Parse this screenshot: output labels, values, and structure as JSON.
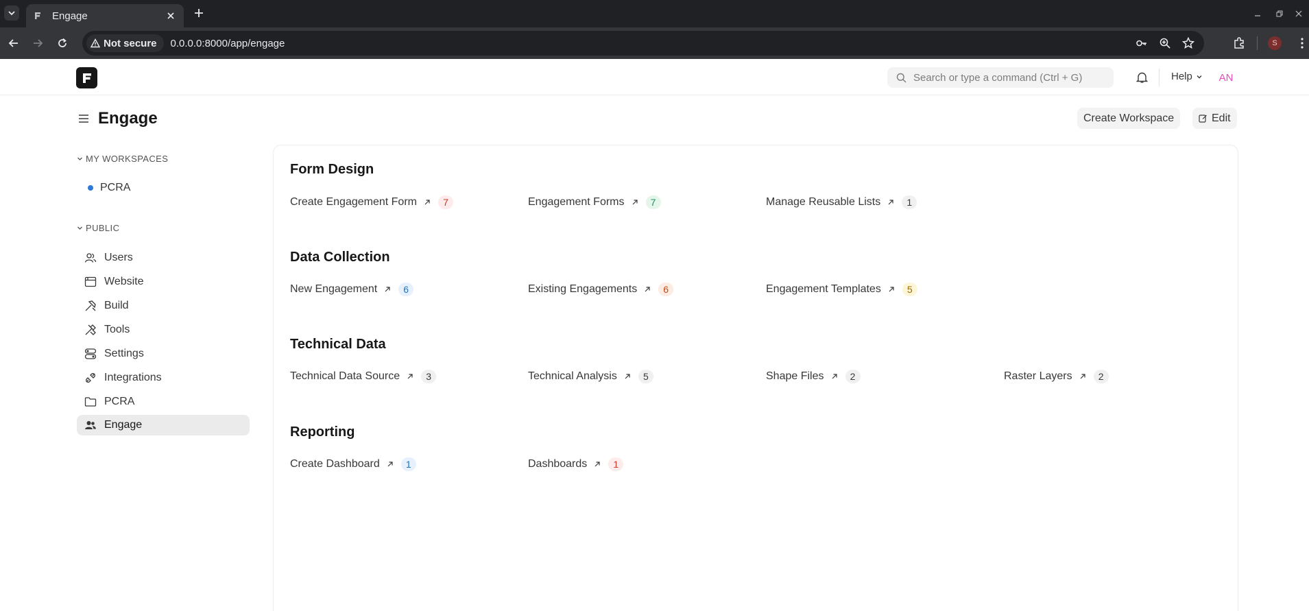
{
  "browser": {
    "tab_title": "Engage",
    "security_label": "Not secure",
    "url": "0.0.0.0:8000/app/engage",
    "profile_initial": "S"
  },
  "navbar": {
    "search_placeholder": "Search or type a command (Ctrl + G)",
    "help_label": "Help",
    "avatar_initials": "AN"
  },
  "page": {
    "title": "Engage",
    "create_workspace_label": "Create Workspace",
    "edit_label": "Edit"
  },
  "sidebar": {
    "my_workspaces_label": "MY WORKSPACES",
    "my_workspaces": [
      {
        "label": "PCRA"
      }
    ],
    "public_label": "PUBLIC",
    "public_items": [
      {
        "label": "Users",
        "icon": "users-icon"
      },
      {
        "label": "Website",
        "icon": "website-icon"
      },
      {
        "label": "Build",
        "icon": "build-icon"
      },
      {
        "label": "Tools",
        "icon": "tools-icon"
      },
      {
        "label": "Settings",
        "icon": "settings-icon"
      },
      {
        "label": "Integrations",
        "icon": "integrations-icon"
      },
      {
        "label": "PCRA",
        "icon": "folder-icon"
      },
      {
        "label": "Engage",
        "icon": "people-icon",
        "active": true
      }
    ]
  },
  "groups": [
    {
      "title": "Form Design",
      "links": [
        {
          "label": "Create Engagement Form",
          "count": "7",
          "tone": "red"
        },
        {
          "label": "Engagement Forms",
          "count": "7",
          "tone": "green"
        },
        {
          "label": "Manage Reusable Lists",
          "count": "1",
          "tone": "gray"
        }
      ]
    },
    {
      "title": "Data Collection",
      "links": [
        {
          "label": "New Engagement",
          "count": "6",
          "tone": "blue"
        },
        {
          "label": "Existing Engagements",
          "count": "6",
          "tone": "orange"
        },
        {
          "label": "Engagement Templates",
          "count": "5",
          "tone": "yellow"
        }
      ]
    },
    {
      "title": "Technical Data",
      "links": [
        {
          "label": "Technical Data Source",
          "count": "3",
          "tone": "gray"
        },
        {
          "label": "Technical Analysis",
          "count": "5",
          "tone": "gray"
        },
        {
          "label": "Shape Files",
          "count": "2",
          "tone": "gray"
        },
        {
          "label": "Raster Layers",
          "count": "2",
          "tone": "gray"
        }
      ]
    },
    {
      "title": "Reporting",
      "links": [
        {
          "label": "Create Dashboard",
          "count": "1",
          "tone": "blue"
        },
        {
          "label": "Dashboards",
          "count": "1",
          "tone": "red"
        }
      ]
    }
  ],
  "colors": {
    "red": {
      "bg": "#fdeceb",
      "fg": "#c93a2b"
    },
    "green": {
      "bg": "#e4f5e9",
      "fg": "#278f5e"
    },
    "gray": {
      "bg": "#f0f0f0",
      "fg": "#383838"
    },
    "blue": {
      "bg": "#e6f1fd",
      "fg": "#1f73c4"
    },
    "orange": {
      "bg": "#fdece3",
      "fg": "#c04a12"
    },
    "yellow": {
      "bg": "#fdf5d7",
      "fg": "#9a6a06"
    }
  }
}
